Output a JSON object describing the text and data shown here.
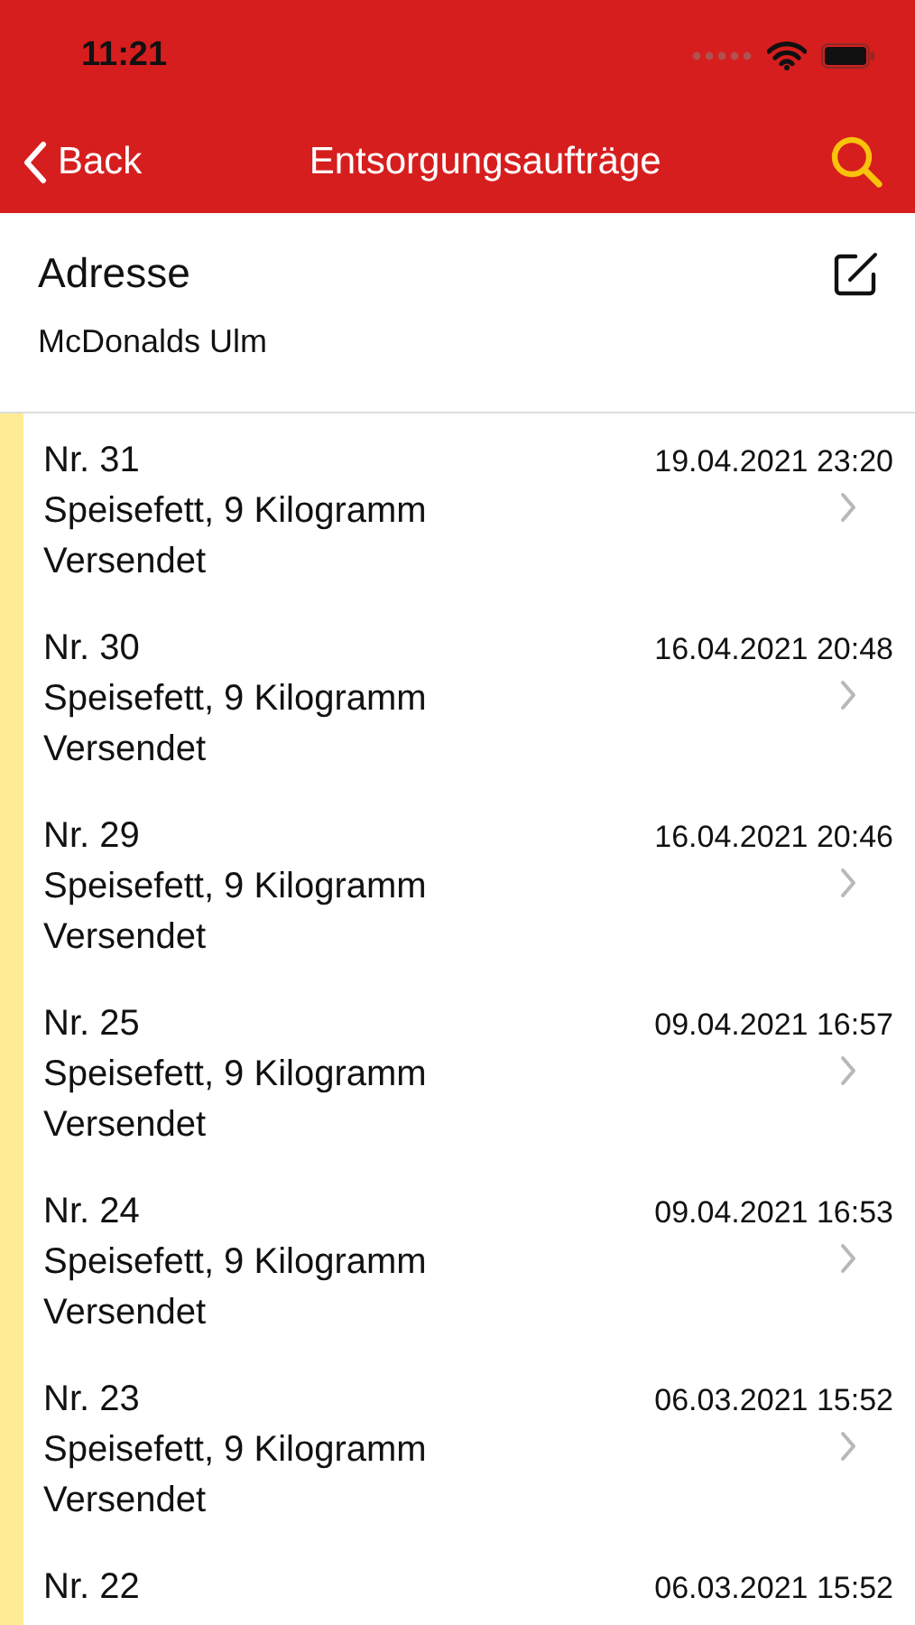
{
  "status_bar": {
    "time": "11:21"
  },
  "nav": {
    "back": "Back",
    "title": "Entsorgungsaufträge"
  },
  "address": {
    "label": "Adresse",
    "value": "McDonalds Ulm"
  },
  "orders": [
    {
      "number": "Nr. 31",
      "description": "Speisefett, 9 Kilogramm",
      "status": "Versendet",
      "date": "19.04.2021 23:20",
      "color": "#fdeb95"
    },
    {
      "number": "Nr. 30",
      "description": "Speisefett, 9 Kilogramm",
      "status": "Versendet",
      "date": "16.04.2021 20:48",
      "color": "#fdeb95"
    },
    {
      "number": "Nr. 29",
      "description": "Speisefett, 9 Kilogramm",
      "status": "Versendet",
      "date": "16.04.2021 20:46",
      "color": "#fdeb95"
    },
    {
      "number": "Nr. 25",
      "description": "Speisefett, 9 Kilogramm",
      "status": "Versendet",
      "date": "09.04.2021 16:57",
      "color": "#fdeb95"
    },
    {
      "number": "Nr. 24",
      "description": "Speisefett, 9 Kilogramm",
      "status": "Versendet",
      "date": "09.04.2021 16:53",
      "color": "#fdeb95"
    },
    {
      "number": "Nr. 23",
      "description": "Speisefett, 9 Kilogramm",
      "status": "Versendet",
      "date": "06.03.2021 15:52",
      "color": "#fdeb95"
    },
    {
      "number": "Nr. 22",
      "date": "06.03.2021 15:52",
      "color": "#fdeb95"
    }
  ]
}
